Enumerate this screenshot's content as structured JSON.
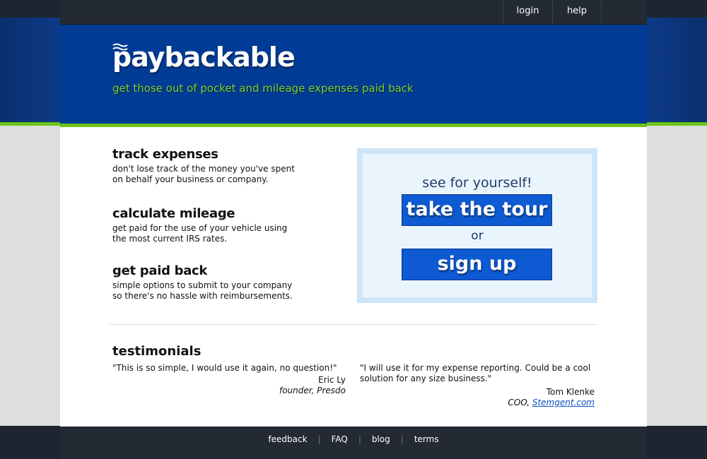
{
  "topnav": {
    "login": "login",
    "help": "help"
  },
  "header": {
    "logo": "paybackable",
    "tagline": "get those out of pocket and mileage expenses paid back"
  },
  "features": [
    {
      "title": "track expenses",
      "line1": "don't lose track of the money you've spent",
      "line2": "on behalf your business or company."
    },
    {
      "title": "calculate mileage",
      "line1": "get paid for the use of your vehicle using",
      "line2": "the most current IRS rates."
    },
    {
      "title": "get paid back",
      "line1": "simple options to submit to your company",
      "line2": "so there's no hassle with reimbursements."
    }
  ],
  "cta": {
    "see": "see for yourself!",
    "tour": "take the tour",
    "or": "or",
    "signup": "sign up"
  },
  "testimonials": {
    "title": "testimonials",
    "items": [
      {
        "quote": "\"This is so simple, I would use it again, no question!\"",
        "name": "Eric Ly",
        "role": "founder, Presdo",
        "link": ""
      },
      {
        "quote": "\"I will use it for my expense reporting. Could be a cool solution for any size business.\"",
        "name": "Tom Klenke",
        "role": "COO, ",
        "link": "Stemgent.com"
      }
    ]
  },
  "footer": {
    "feedback": "feedback",
    "faq": "FAQ",
    "blog": "blog",
    "terms": "terms",
    "separator": "|"
  },
  "colors": {
    "brand_blue": "#003c96",
    "accent_green": "#6cc417",
    "button_blue": "#0e5ad2",
    "dark_bar": "#232a33"
  }
}
